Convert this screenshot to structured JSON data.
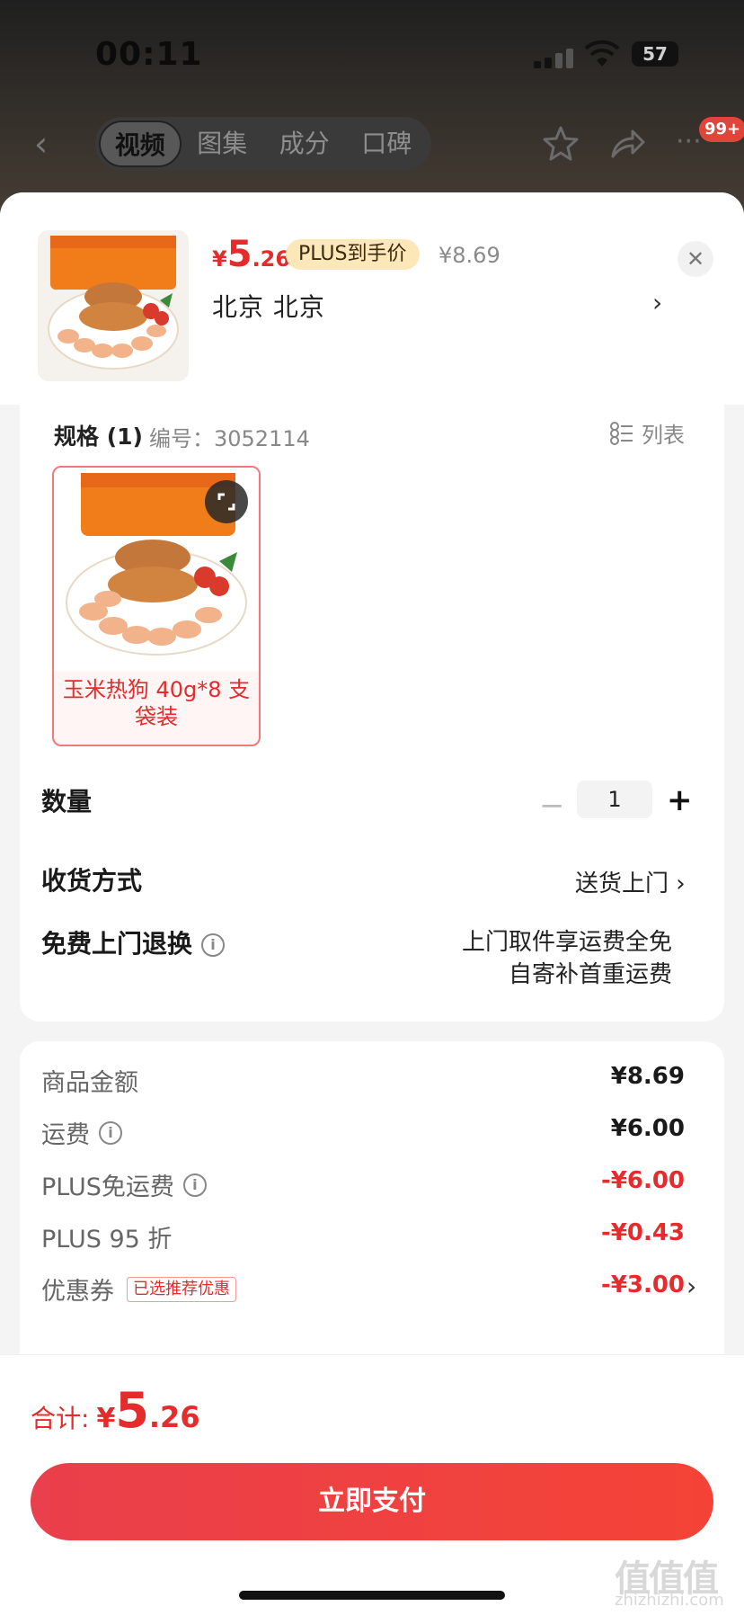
{
  "status_bar": {
    "time": "00:11",
    "battery": "57"
  },
  "nav": {
    "tabs": [
      {
        "label": "视频",
        "active": true
      },
      {
        "label": "图集",
        "active": false
      },
      {
        "label": "成分",
        "active": false
      },
      {
        "label": "口碑",
        "active": false
      }
    ],
    "badge": "99+"
  },
  "product": {
    "price_symbol": "¥",
    "price_int": "5",
    "price_dec": ".26",
    "plus_tag": "PLUS到手价",
    "original_price": "¥8.69",
    "address": "北京  北京"
  },
  "spec": {
    "title": "规格 (1)",
    "code": "编号：3052114",
    "list_label": "列表",
    "sku_label": "玉米热狗 40g*8 支袋装"
  },
  "quantity": {
    "label": "数量",
    "value": "1"
  },
  "delivery": {
    "label": "收货方式",
    "value": "送货上门"
  },
  "returns": {
    "label": "免费上门退换",
    "line1": "上门取件享运费全免",
    "line2": "自寄补首重运费"
  },
  "fees": [
    {
      "label": "商品金额",
      "value": "¥8.69",
      "red": false
    },
    {
      "label": "运费",
      "value": "¥6.00",
      "red": false
    },
    {
      "label": "PLUS免运费",
      "value": "-¥6.00",
      "red": true
    },
    {
      "label": "PLUS 95 折",
      "value": "-¥0.43",
      "red": true
    },
    {
      "label": "优惠券",
      "value": "-¥3.00",
      "red": true,
      "tag": "已选推荐优惠"
    }
  ],
  "footer": {
    "total_label": "合计:",
    "total_symbol": "¥",
    "total_int": "5",
    "total_dec": ".26",
    "pay_button": "立即支付"
  },
  "watermark": {
    "logo": "值值值",
    "site": "zhizhizhi.com"
  },
  "colors": {
    "accent": "#e52b2b",
    "plus_tag_bg": "#fbe7b7",
    "pay_button": "#f44336"
  }
}
